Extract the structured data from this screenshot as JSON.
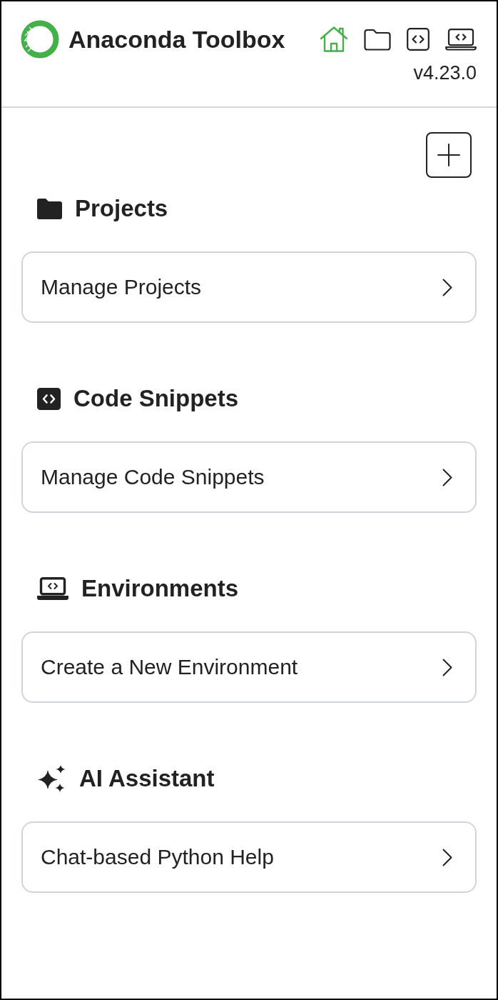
{
  "header": {
    "title": "Anaconda Toolbox",
    "version": "v4.23.0",
    "nav_icons": [
      {
        "kind": "home",
        "selected": true
      },
      {
        "kind": "folder",
        "selected": false
      },
      {
        "kind": "code",
        "selected": false
      },
      {
        "kind": "laptop",
        "selected": false
      }
    ]
  },
  "sections": [
    {
      "kind": "folder",
      "title": "Projects",
      "action": "Manage Projects"
    },
    {
      "kind": "code",
      "title": "Code Snippets",
      "action": "Manage Code Snippets"
    },
    {
      "kind": "laptop",
      "title": "Environments",
      "action": "Create a New Environment"
    },
    {
      "kind": "sparkles",
      "title": "AI Assistant",
      "action": "Chat-based Python Help"
    }
  ]
}
